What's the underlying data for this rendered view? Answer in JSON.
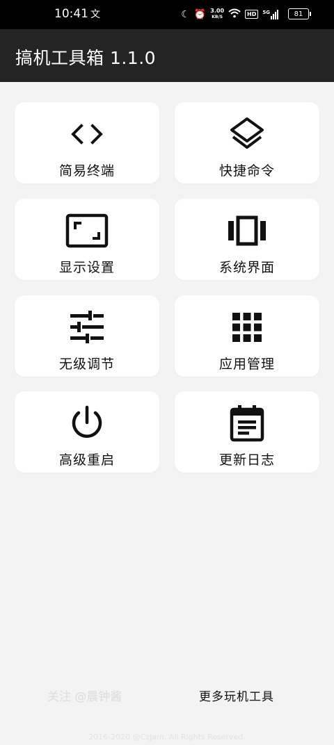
{
  "status_bar": {
    "time": "10:41",
    "notif_icon": "translate-notification-icon",
    "speed_value": "3.00",
    "speed_unit": "KB/S",
    "hd": "HD",
    "network": "5G",
    "battery": "81"
  },
  "app_bar": {
    "title": "搞机工具箱 1.1.0"
  },
  "tiles": [
    {
      "label": "简易终端",
      "icon": "code-brackets-icon"
    },
    {
      "label": "快捷命令",
      "icon": "layers-icon"
    },
    {
      "label": "显示设置",
      "icon": "aspect-ratio-icon"
    },
    {
      "label": "系统界面",
      "icon": "view-carousel-icon"
    },
    {
      "label": "无级调节",
      "icon": "tune-sliders-icon"
    },
    {
      "label": "应用管理",
      "icon": "apps-grid-icon"
    },
    {
      "label": "高级重启",
      "icon": "power-icon"
    },
    {
      "label": "更新日志",
      "icon": "calendar-notes-icon"
    }
  ],
  "footer": {
    "follow": "关注 @晨钟酱",
    "more_tools": "更多玩机工具",
    "copyright": "2016-2020 @CzJam. All Rights Reserved."
  },
  "colors": {
    "app_bar": "#242424",
    "background": "#f3f3f3",
    "card": "#ffffff",
    "icon": "#111111"
  }
}
